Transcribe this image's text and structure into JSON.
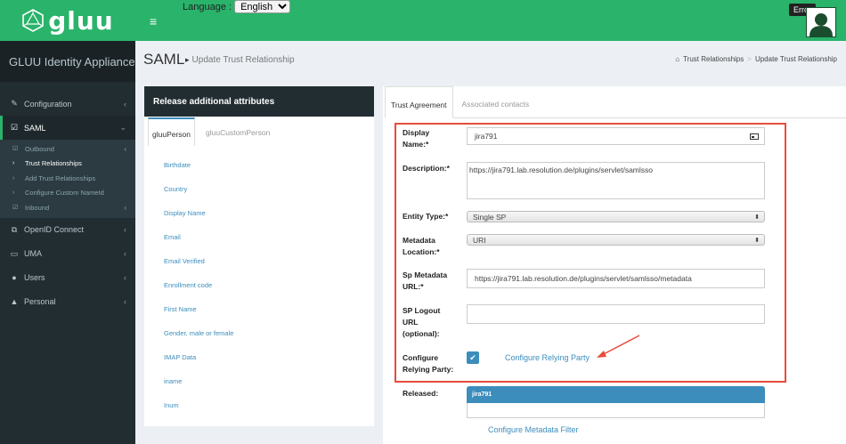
{
  "header": {
    "logo_text": "gluu",
    "language_label": "Language :",
    "language_value": "English",
    "error_badge": "Error"
  },
  "sidebar": {
    "app_title": "GLUU Identity Appliance",
    "items": [
      {
        "label": "Configuration",
        "icon": "wrench-icon"
      },
      {
        "label": "SAML",
        "icon": "edit-icon"
      },
      {
        "label": "OpenID Connect",
        "icon": "external-link-icon"
      },
      {
        "label": "UMA",
        "icon": "folder-icon"
      },
      {
        "label": "Users",
        "icon": "users-icon"
      },
      {
        "label": "Personal",
        "icon": "user-icon"
      }
    ],
    "saml_sub": [
      {
        "label": "Outbound"
      },
      {
        "label": "Trust Relationships"
      },
      {
        "label": "Add Trust Relationships"
      },
      {
        "label": "Configure Custom NameId"
      },
      {
        "label": "Inbound"
      }
    ]
  },
  "page": {
    "title": "SAML",
    "subtitle": "Update Trust Relationship",
    "breadcrumb": [
      "Trust Relationships",
      "Update Trust Relationship"
    ]
  },
  "attributes": {
    "header": "Release additional attributes",
    "tabs": [
      "gluuPerson",
      "gluuCustomPerson"
    ],
    "items": [
      "Birthdate",
      "Country",
      "Display Name",
      "Email",
      "Email Verified",
      "Enrollment code",
      "First Name",
      "Gender, male or female",
      "IMAP Data",
      "iname",
      "Inum"
    ]
  },
  "trust": {
    "tabs": [
      "Trust Agreement",
      "Associated contacts"
    ],
    "display_name_label": "Display Name:*",
    "display_name_value": "jira791",
    "description_label": "Description:*",
    "description_value": "https://jira791.lab.resolution.de/plugins/servlet/samlsso",
    "entity_type_label": "Entity Type:*",
    "entity_type_value": "Single SP",
    "metadata_location_label": "Metadata Location:*",
    "metadata_location_value": "URI",
    "sp_metadata_url_label": "Sp Metadata URL:*",
    "sp_metadata_url_value": "https://jira791.lab.resolution.de/plugins/servlet/samlsso/metadata",
    "sp_logout_label": "SP Logout URL (optional):",
    "sp_logout_value": "",
    "configure_rp_label": "Configure Relying Party:",
    "configure_rp_link": "Configure Relying Party",
    "released_label": "Released:",
    "released_value": "jira791",
    "metadata_filter_link": "Configure Metadata Filter"
  },
  "colors": {
    "topbar": "#2ab36a",
    "sidebar": "#222d32",
    "accent": "#3c8dbc",
    "highlight_box": "#e74c3c"
  }
}
